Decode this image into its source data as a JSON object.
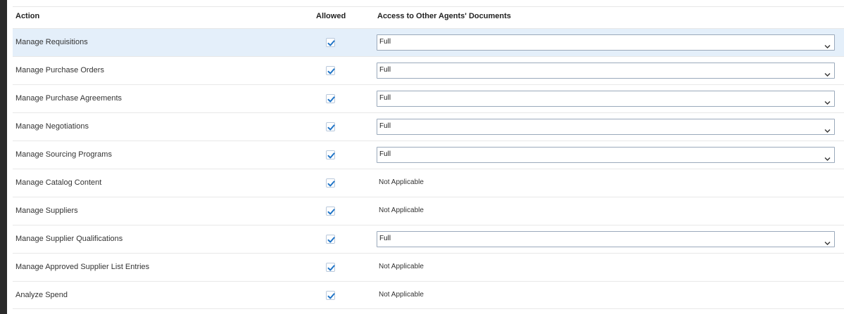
{
  "table": {
    "headers": {
      "action": "Action",
      "allowed": "Allowed",
      "access": "Access to Other Agents' Documents"
    },
    "rows": [
      {
        "action": "Manage Requisitions",
        "allowed": true,
        "access": "Full",
        "access_type": "select",
        "selected": true
      },
      {
        "action": "Manage Purchase Orders",
        "allowed": true,
        "access": "Full",
        "access_type": "select"
      },
      {
        "action": "Manage Purchase Agreements",
        "allowed": true,
        "access": "Full",
        "access_type": "select"
      },
      {
        "action": "Manage Negotiations",
        "allowed": true,
        "access": "Full",
        "access_type": "select"
      },
      {
        "action": "Manage Sourcing Programs",
        "allowed": true,
        "access": "Full",
        "access_type": "select"
      },
      {
        "action": "Manage Catalog Content",
        "allowed": true,
        "access": "Not Applicable",
        "access_type": "text"
      },
      {
        "action": "Manage Suppliers",
        "allowed": true,
        "access": "Not Applicable",
        "access_type": "text"
      },
      {
        "action": "Manage Supplier Qualifications",
        "allowed": true,
        "access": "Full",
        "access_type": "select"
      },
      {
        "action": "Manage Approved Supplier List Entries",
        "allowed": true,
        "access": "Not Applicable",
        "access_type": "text"
      },
      {
        "action": "Analyze Spend",
        "allowed": true,
        "access": "Not Applicable",
        "access_type": "text"
      }
    ]
  },
  "colors": {
    "selected_row": "#e4effa",
    "checkmark": "#1f74c7"
  }
}
